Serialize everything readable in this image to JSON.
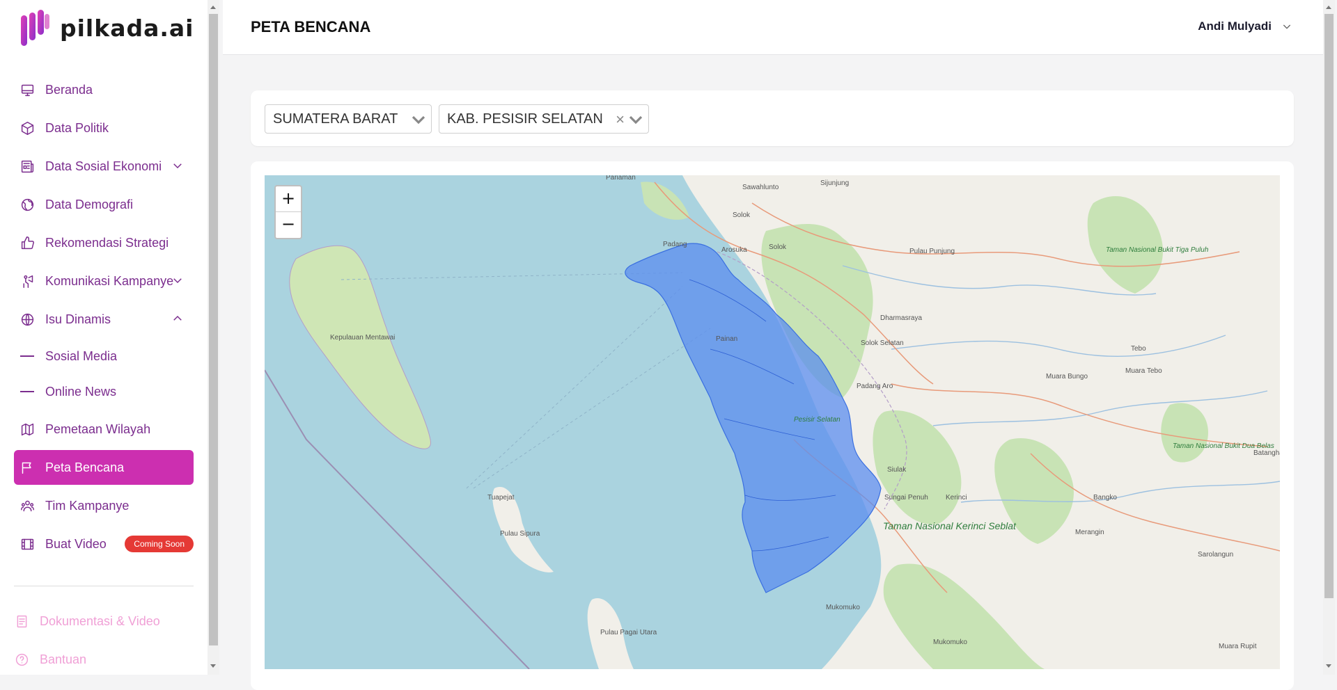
{
  "app": {
    "logo_text": "pilkada.ai",
    "brand_color": "#cc2fb0"
  },
  "sidebar": {
    "items": [
      {
        "label": "Beranda",
        "icon": "monitor-icon"
      },
      {
        "label": "Data Politik",
        "icon": "cube-icon"
      },
      {
        "label": "Data Sosial Ekonomi",
        "icon": "newspaper-icon",
        "expandable": true
      },
      {
        "label": "Data Demografi",
        "icon": "globe-icon"
      },
      {
        "label": "Rekomendasi Strategi",
        "icon": "thumbs-up-icon"
      },
      {
        "label": "Komunikasi Kampanye",
        "icon": "megaphone-icon",
        "expandable": true
      },
      {
        "label": "Isu Dinamis",
        "icon": "globe-grid-icon",
        "expanded": true
      },
      {
        "label": "Sosial Media",
        "sub": true
      },
      {
        "label": "Online News",
        "sub": true
      },
      {
        "label": "Pemetaan Wilayah",
        "icon": "map-icon"
      },
      {
        "label": "Peta Bencana",
        "icon": "flag-icon",
        "active": true
      },
      {
        "label": "Tim Kampanye",
        "icon": "team-icon"
      },
      {
        "label": "Buat Video",
        "icon": "film-icon",
        "badge": "Coming Soon"
      }
    ],
    "footer": [
      {
        "label": "Dokumentasi & Video",
        "icon": "document-icon"
      },
      {
        "label": "Bantuan",
        "icon": "help-icon"
      }
    ]
  },
  "header": {
    "title": "PETA BENCANA",
    "user_name": "Andi Mulyadi"
  },
  "filters": {
    "province": "SUMATERA BARAT",
    "regency": "KAB. PESISIR SELATAN"
  },
  "map": {
    "zoom_in": "+",
    "zoom_out": "−",
    "highlight_color": "#5b8def",
    "places": [
      "Pariaman",
      "Sawahlunto",
      "Sijunjung",
      "Solok",
      "Padang",
      "Arosuka",
      "Solok",
      "Pulau Punjung",
      "Taman Nasional Bukit Tiga Puluh",
      "Dharmasraya",
      "Painan",
      "Kepulauan Mentawai",
      "Solok Selatan",
      "Tebo",
      "Muara Bungo",
      "Muara Tebo",
      "Padang Aro",
      "Pesisir Selatan",
      "Siulak",
      "Kerinci",
      "Taman Nasional Bukit Dua Belas",
      "Batanghari",
      "Sungai Penuh",
      "Taman Nasional Kerinci Seblat",
      "Tuapejat",
      "Pulau Sipura",
      "Bangko",
      "Merangin",
      "Sarolangun",
      "Mukomuko",
      "Pulau Pagai Utara",
      "Mukomuko",
      "Muara Rupit"
    ]
  }
}
